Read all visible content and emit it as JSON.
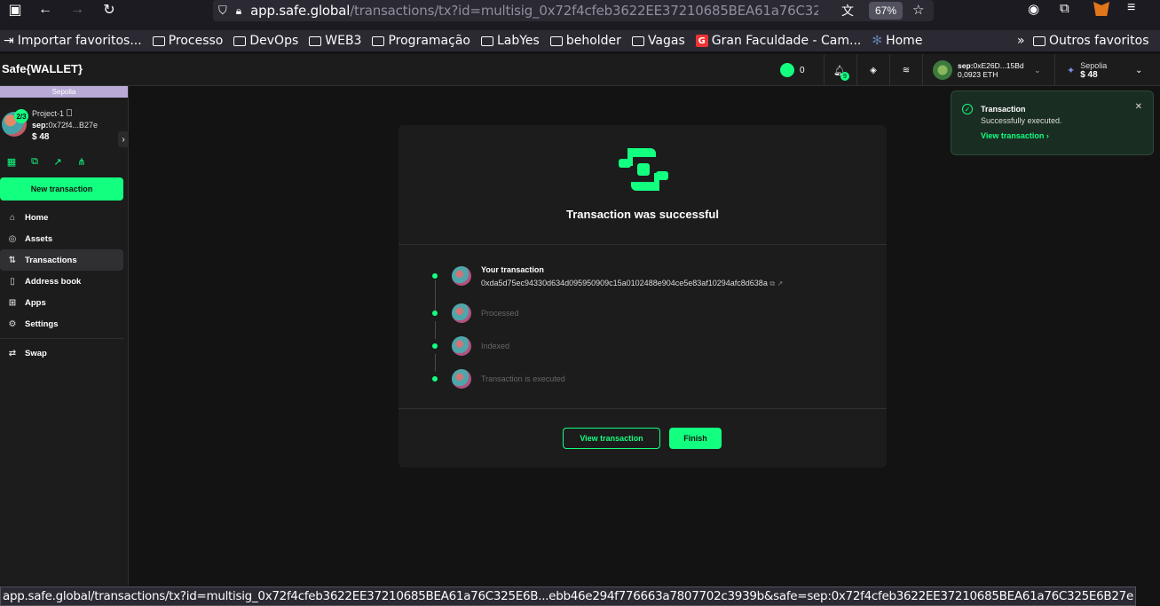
{
  "browser": {
    "url_host": "app.safe.global",
    "url_path": "/transactions/tx?id=multisig_0x72f4cfeb3622EE37210685BEA61a76C325E6B",
    "zoom": "67%"
  },
  "bookmarks": [
    {
      "label": "Importar favoritos...",
      "icon": "import-icon"
    },
    {
      "label": "Processo",
      "icon": "folder-icon"
    },
    {
      "label": "DevOps",
      "icon": "folder-icon"
    },
    {
      "label": "WEB3",
      "icon": "folder-icon"
    },
    {
      "label": "Programação",
      "icon": "folder-icon"
    },
    {
      "label": "LabYes",
      "icon": "folder-icon"
    },
    {
      "label": "beholder",
      "icon": "folder-icon"
    },
    {
      "label": "Vagas",
      "icon": "folder-icon"
    },
    {
      "label": "Gran Faculdade - Cam...",
      "icon": "g-logo-icon"
    },
    {
      "label": "Home",
      "icon": "gear-icon"
    }
  ],
  "bookmarks_other": "Outros favoritos",
  "header": {
    "brand": "Safe{WALLET}",
    "points": "0",
    "notifications_count": "9",
    "wallet_address": "sep:0xE26D...15Bd",
    "wallet_address_prefix": "sep:",
    "wallet_address_rest": "0xE26D...15Bd",
    "wallet_balance": "0,0923 ETH",
    "network_name": "Sepolia",
    "network_balance": "$ 48"
  },
  "sidebar": {
    "network_label": "Sepolia",
    "threshold": "2/3",
    "safe_name": "Project-1",
    "safe_address_prefix": "sep:",
    "safe_address": "0x72f4...B27e",
    "safe_balance": "$ 48",
    "new_transaction": "New transaction",
    "nav": [
      {
        "label": "Home",
        "icon": "home-icon"
      },
      {
        "label": "Assets",
        "icon": "assets-icon"
      },
      {
        "label": "Transactions",
        "icon": "transactions-icon",
        "active": true
      },
      {
        "label": "Address book",
        "icon": "address-book-icon"
      },
      {
        "label": "Apps",
        "icon": "apps-icon"
      },
      {
        "label": "Settings",
        "icon": "settings-icon"
      }
    ],
    "swap": "Swap"
  },
  "card": {
    "title": "Transaction was successful",
    "steps": [
      {
        "label": "Your transaction",
        "hash": "0xda5d75ec94330d634d095950909c15a0102488e904ce5e83af10294afc8d638a"
      },
      {
        "label": "Processed"
      },
      {
        "label": "Indexed"
      },
      {
        "label": "Transaction is executed"
      }
    ],
    "view_button": "View transaction",
    "finish_button": "Finish"
  },
  "toast": {
    "title": "Transaction",
    "message": "Successfully executed.",
    "link": "View transaction"
  },
  "status_bar_url": "app.safe.global/transactions/tx?id=multisig_0x72f4cfeb3622EE37210685BEA61a76C325E6B...ebb46e294f776663a7807702c3939b&safe=sep:0x72f4cfeb3622EE37210685BEA61a76C325E6B27e",
  "colors": {
    "accent": "#12ff80",
    "background": "#121312",
    "surface": "#1c1c1c",
    "network": "#b8aad5"
  }
}
